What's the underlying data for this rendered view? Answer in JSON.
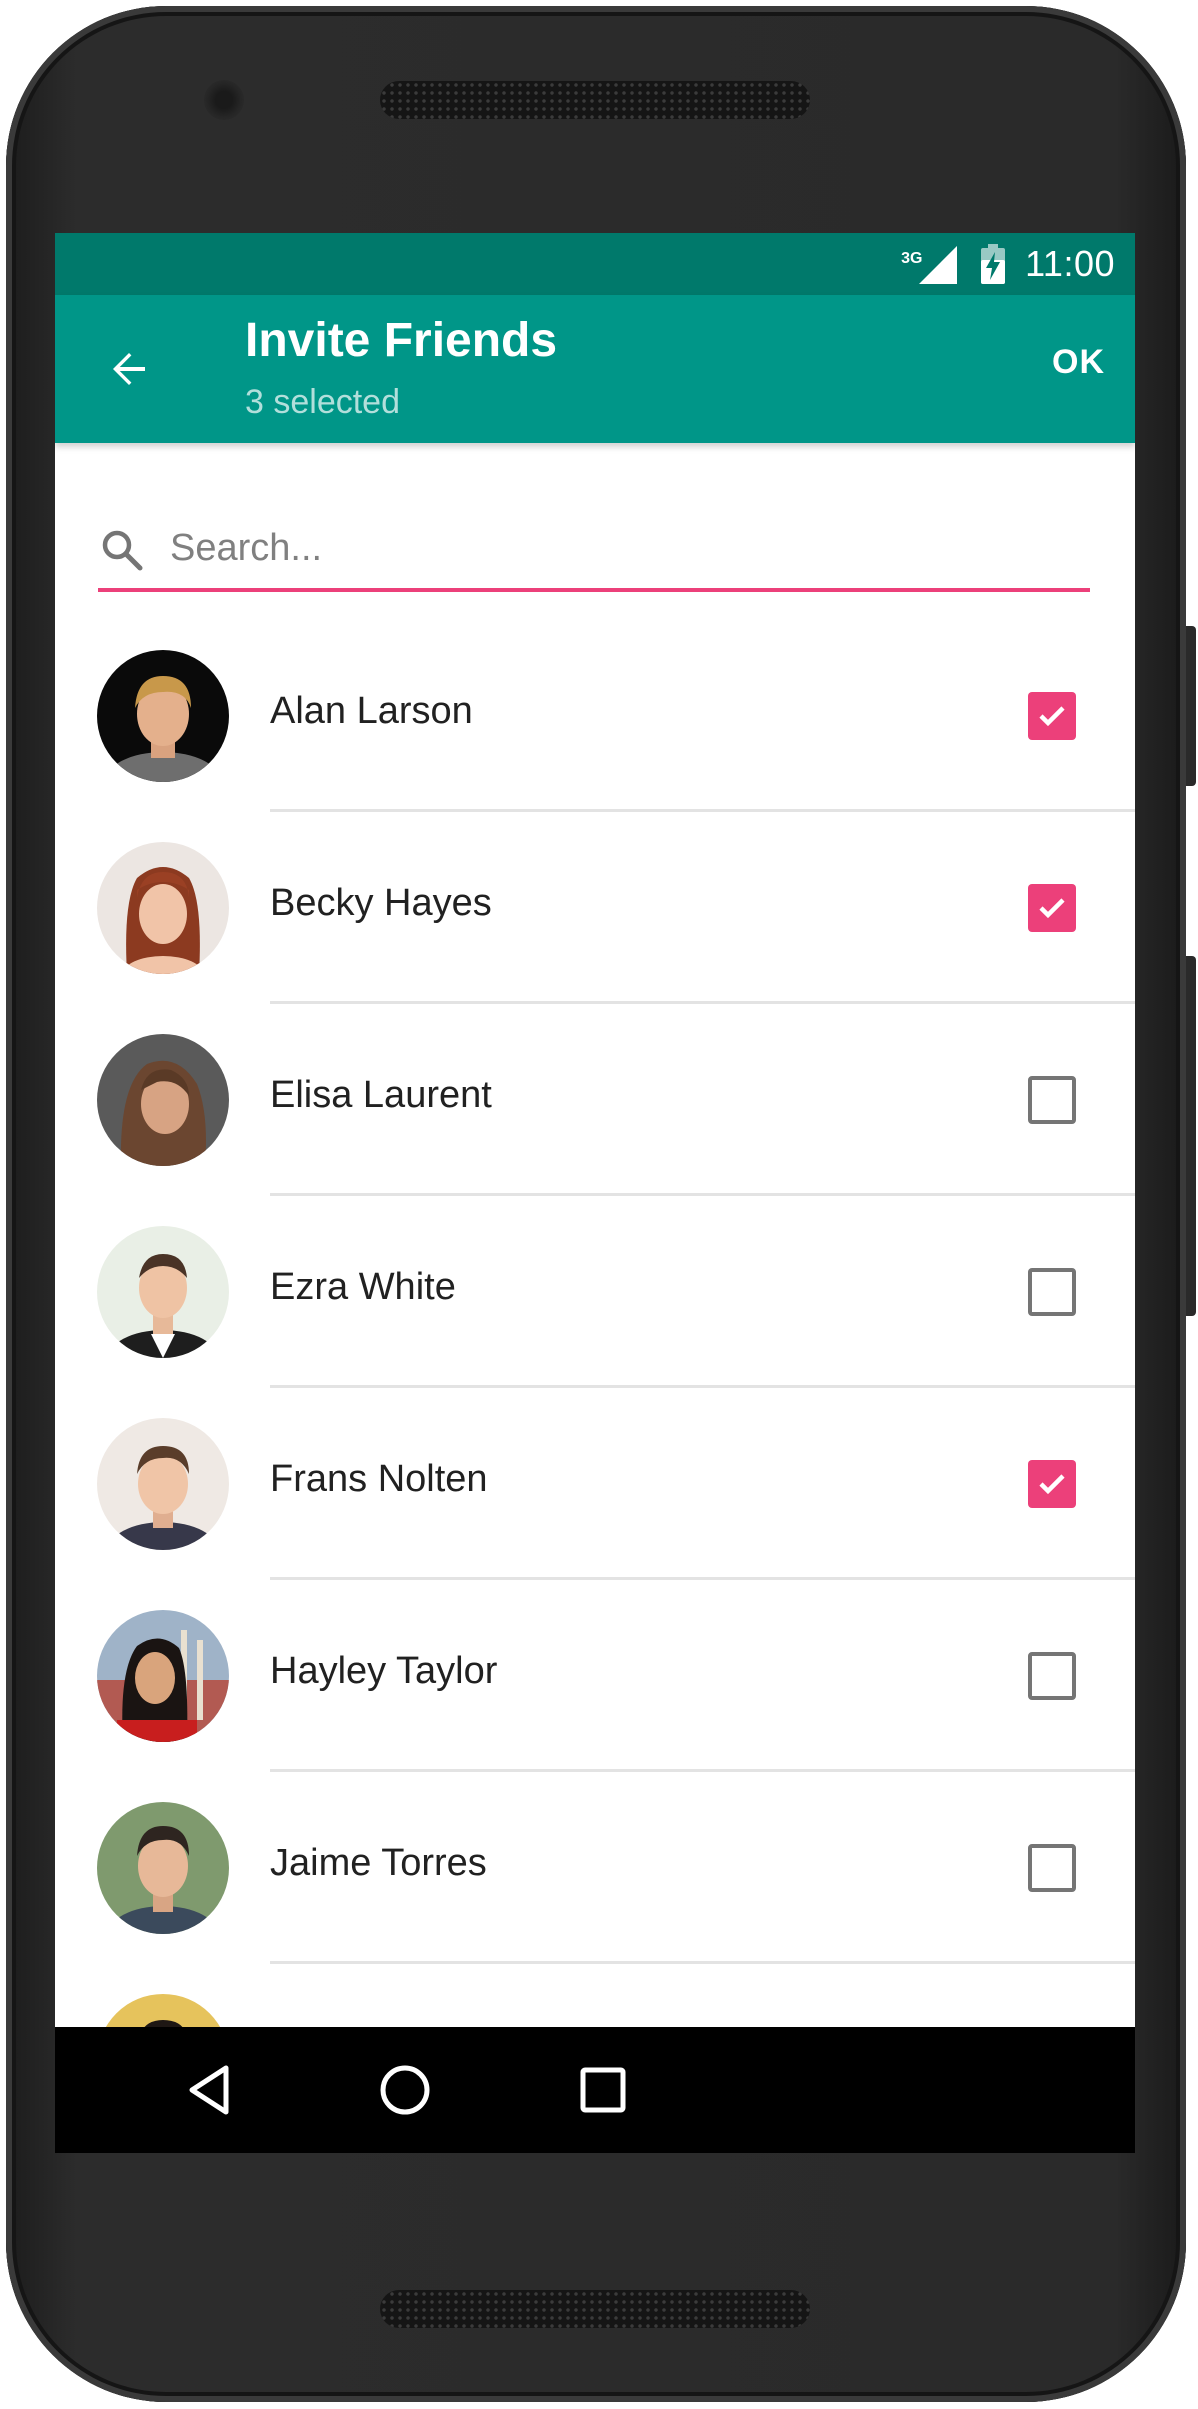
{
  "status_bar": {
    "network_type": "3G",
    "time": "11:00",
    "icons": [
      "signal-icon",
      "battery-charging-icon"
    ]
  },
  "app_bar": {
    "title": "Invite Friends",
    "subtitle": "3 selected",
    "ok_label": "OK",
    "back_icon": "arrow-back-icon"
  },
  "search": {
    "placeholder": "Search...",
    "value": "",
    "icon": "search-icon"
  },
  "friends": [
    {
      "name": "Alan Larson",
      "checked": true
    },
    {
      "name": "Becky Hayes",
      "checked": true
    },
    {
      "name": "Elisa Laurent",
      "checked": false
    },
    {
      "name": "Ezra White",
      "checked": false
    },
    {
      "name": "Frans Nolten",
      "checked": true
    },
    {
      "name": "Hayley Taylor",
      "checked": false
    },
    {
      "name": "Jaime Torres",
      "checked": false
    },
    {
      "name": "",
      "checked": false
    }
  ],
  "nav": {
    "icons": [
      "back-triangle-icon",
      "home-circle-icon",
      "recents-square-icon"
    ]
  },
  "colors": {
    "status_bar": "#00796b",
    "app_bar": "#009688",
    "accent": "#ec407a",
    "subtitle": "#b2dfdb",
    "unchecked_border": "#757575",
    "divider": "#e3e3e3"
  }
}
